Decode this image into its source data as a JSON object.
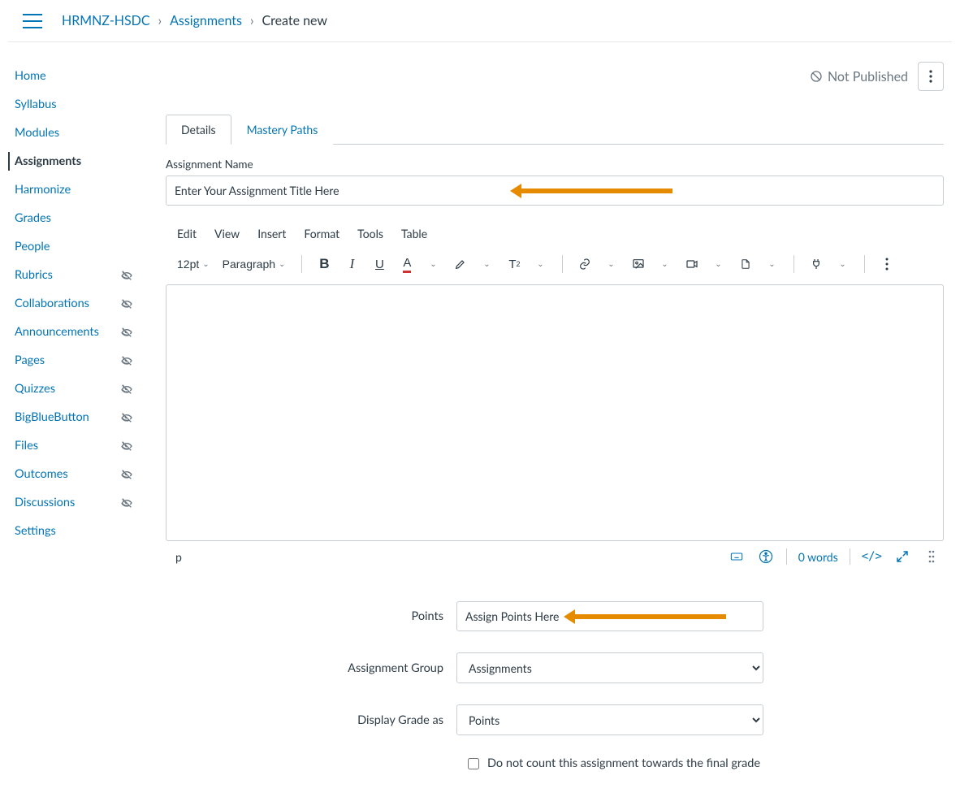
{
  "breadcrumb": {
    "course": "HRMNZ-HSDC",
    "section": "Assignments",
    "current": "Create new"
  },
  "sidebar": {
    "items": [
      {
        "label": "Home",
        "hidden": false
      },
      {
        "label": "Syllabus",
        "hidden": false
      },
      {
        "label": "Modules",
        "hidden": false
      },
      {
        "label": "Assignments",
        "hidden": false,
        "active": true
      },
      {
        "label": "Harmonize",
        "hidden": false
      },
      {
        "label": "Grades",
        "hidden": false
      },
      {
        "label": "People",
        "hidden": false
      },
      {
        "label": "Rubrics",
        "hidden": true
      },
      {
        "label": "Collaborations",
        "hidden": true
      },
      {
        "label": "Announcements",
        "hidden": true
      },
      {
        "label": "Pages",
        "hidden": true
      },
      {
        "label": "Quizzes",
        "hidden": true
      },
      {
        "label": "BigBlueButton",
        "hidden": true
      },
      {
        "label": "Files",
        "hidden": true
      },
      {
        "label": "Outcomes",
        "hidden": true
      },
      {
        "label": "Discussions",
        "hidden": true
      },
      {
        "label": "Settings",
        "hidden": false
      }
    ]
  },
  "header": {
    "status": "Not Published"
  },
  "tabs": {
    "details": "Details",
    "mastery": "Mastery Paths"
  },
  "form": {
    "name_label": "Assignment Name",
    "name_value": "Enter Your Assignment Title Here",
    "points_label": "Points",
    "points_value": "Assign Points Here",
    "group_label": "Assignment Group",
    "group_value": "Assignments",
    "display_label": "Display Grade as",
    "display_value": "Points",
    "omit_label": "Do not count this assignment towards the final grade"
  },
  "rce": {
    "menus": [
      "Edit",
      "View",
      "Insert",
      "Format",
      "Tools",
      "Table"
    ],
    "font_size": "12pt",
    "block": "Paragraph",
    "path": "p",
    "word_count": "0 words",
    "code": "</>"
  }
}
